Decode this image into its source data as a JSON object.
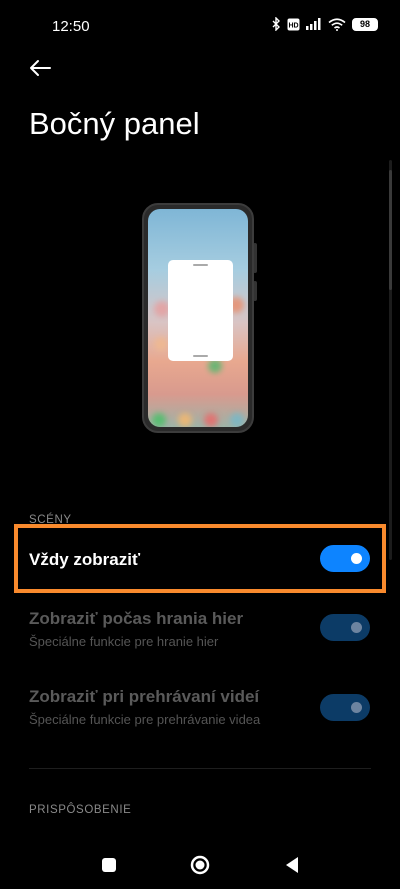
{
  "status_bar": {
    "time": "12:50",
    "battery": "98",
    "icons": [
      "bluetooth-icon",
      "volte-icon",
      "signal-icon",
      "wifi-icon",
      "battery-icon"
    ]
  },
  "header": {
    "back_icon": "arrow-left-icon",
    "title": "Bočný panel"
  },
  "scenes": {
    "label": "SCÉNY",
    "items": [
      {
        "title": "Vždy zobraziť",
        "subtitle": "",
        "enabled": true,
        "toggle_on": true
      },
      {
        "title": "Zobraziť počas hrania hier",
        "subtitle": "Špeciálne funkcie pre hranie hier",
        "enabled": false,
        "toggle_on": true
      },
      {
        "title": "Zobraziť pri prehrávaní videí",
        "subtitle": "Špeciálne funkcie pre prehrávanie videa",
        "enabled": false,
        "toggle_on": true
      }
    ]
  },
  "customization": {
    "label": "PRISPÔSOBENIE"
  },
  "nav_bar": {
    "buttons": [
      "recents-square-icon",
      "home-circle-icon",
      "back-triangle-icon"
    ]
  },
  "colors": {
    "accent": "#0d84ff",
    "accent_dim": "#0c3b66",
    "highlight": "#f98a2d",
    "background": "#000000"
  }
}
